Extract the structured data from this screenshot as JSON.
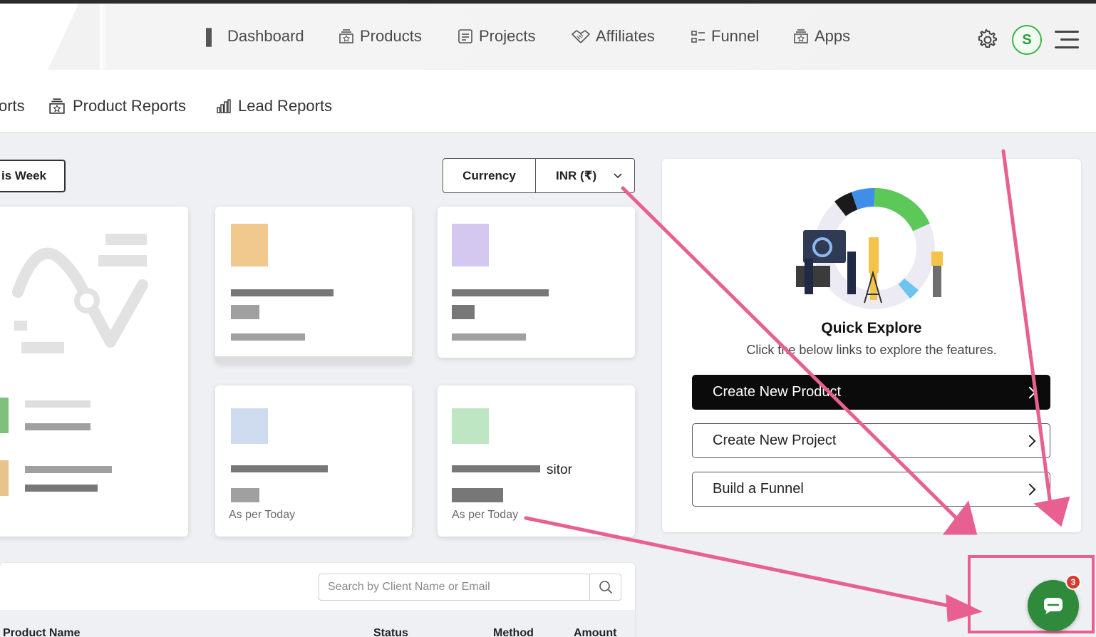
{
  "topnav": {
    "items": [
      {
        "label": "Dashboard",
        "icon": "dashboard-grid-icon"
      },
      {
        "label": "Products",
        "icon": "products-box-icon"
      },
      {
        "label": "Projects",
        "icon": "projects-doc-icon"
      },
      {
        "label": "Affiliates",
        "icon": "handshake-icon"
      },
      {
        "label": "Funnel",
        "icon": "funnel-icon"
      },
      {
        "label": "Apps",
        "icon": "apps-box-icon"
      }
    ],
    "avatar_initial": "S",
    "accent_green": "#3bb54a"
  },
  "subnav": {
    "items": [
      {
        "label": "orts"
      },
      {
        "label": "Product Reports"
      },
      {
        "label": "Lead Reports"
      }
    ]
  },
  "filter": {
    "week_label": "is Week",
    "currency_label": "Currency",
    "currency_value": "INR (₹)"
  },
  "stat_cards": [
    {
      "text": "",
      "footer": ""
    },
    {
      "text": "",
      "footer": "As per Today"
    },
    {
      "text": "sitor",
      "footer": "As per Today"
    }
  ],
  "quick_explore": {
    "title": "Quick Explore",
    "description": "Click the below links to explore the features.",
    "buttons": [
      {
        "label": "Create New Product"
      },
      {
        "label": "Create New Project"
      },
      {
        "label": "Build a Funnel"
      }
    ]
  },
  "table": {
    "search_placeholder": "Search by Client Name or Email",
    "columns": [
      "Product Name",
      "Status",
      "Method",
      "Amount"
    ]
  },
  "chat": {
    "badge_count": "3",
    "color": "#2f8a3b",
    "highlight_color": "#e8608f"
  }
}
